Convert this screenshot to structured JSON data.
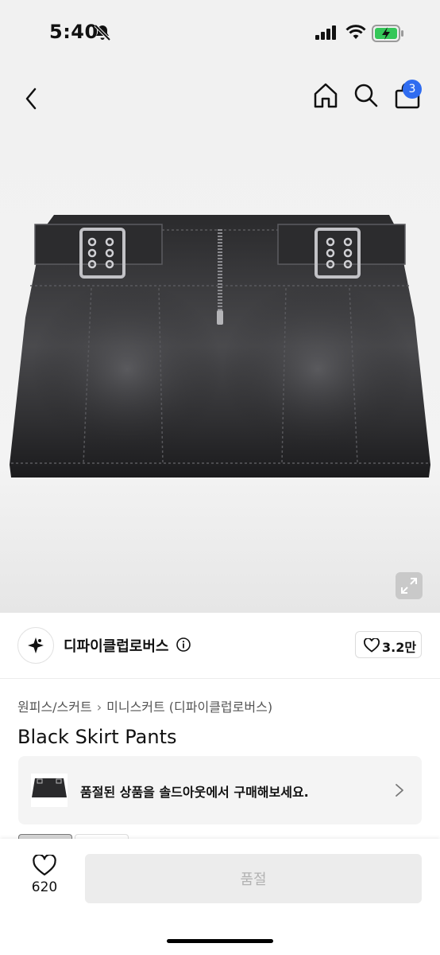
{
  "status": {
    "time": "5:40"
  },
  "nav": {
    "cart_count": "3"
  },
  "brand": {
    "name": "디파이클럽로버스",
    "likes": "3.2만"
  },
  "breadcrumb": [
    "원피스/스커트",
    "미니스커트 (디파이클럽로버스)"
  ],
  "product": {
    "title": "Black Skirt Pants"
  },
  "banner": {
    "text": "품절된 상품을 솔드아웃에서 구매해보세요."
  },
  "bottom": {
    "wish_count": "620",
    "buy_label": "품절"
  },
  "colors": {
    "badge": "#2f6cf0",
    "battery": "#35c759",
    "denim": "#1c1c1e"
  }
}
